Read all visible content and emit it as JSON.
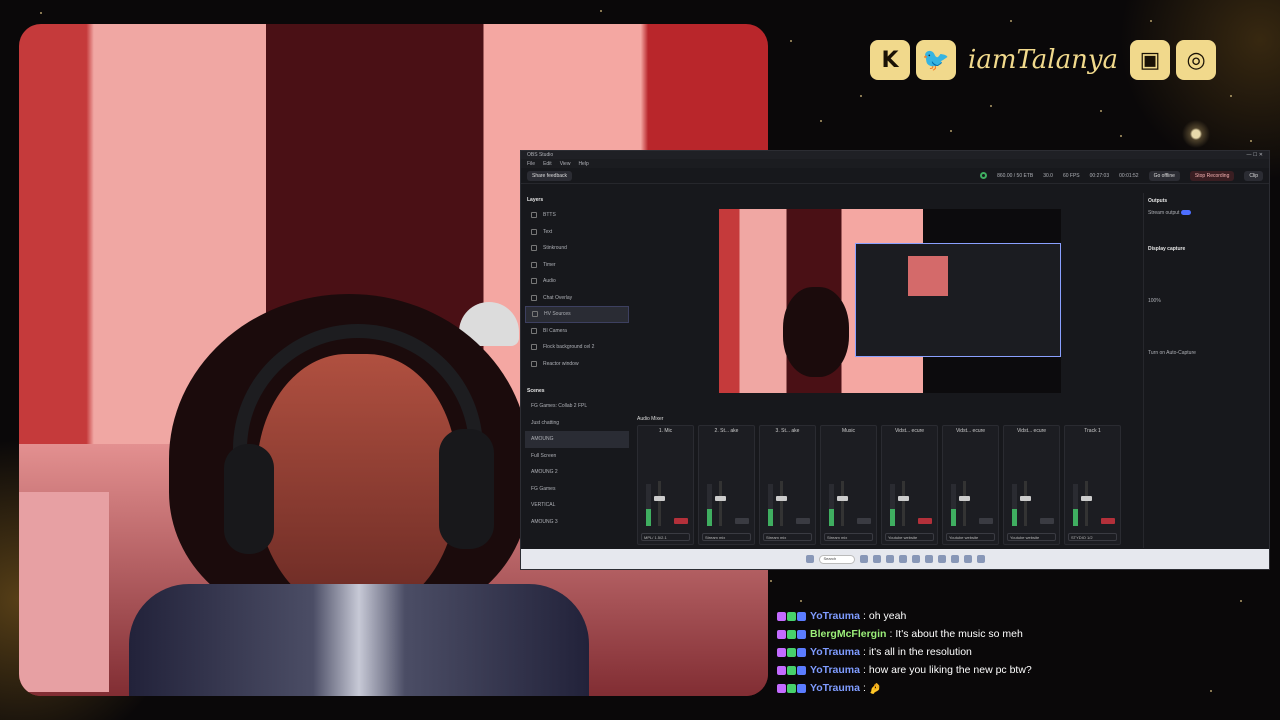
{
  "overlay": {
    "social_handle": "iamTalanya",
    "social_icons": [
      "kick-icon",
      "twitter-icon",
      "twitch-icon",
      "instagram-icon"
    ],
    "accent_color": "#f1d98c"
  },
  "obs": {
    "window_title": "OBS Studio",
    "menu": [
      "File",
      "Edit",
      "View",
      "Help"
    ],
    "share_feedback": "Share feedback",
    "stats": {
      "bitrate": "860.00 / 50 ETB",
      "cpu": "30.0",
      "fps": "60 FPS",
      "stream_time": "00:27:03",
      "rec_time": "00:01:52"
    },
    "go_offline": "Go offline",
    "stop_recording": "Stop Recording",
    "clip": "Clip",
    "layers_title": "Layers",
    "layers": [
      "BTTS",
      "Text",
      "Stinkround",
      "Timer",
      "Audio",
      "Chat Overlay",
      "HV Sources",
      "BI Camera",
      "Flock background cel 2",
      "Reactor window"
    ],
    "scenes_title": "Scenes",
    "scenes": [
      "FG Games: Collab 2 FPL",
      "Just chatting",
      "AMOUNG",
      "Full Screen",
      "AMOUNG 2",
      "FG Games",
      "VERTICAL",
      "AMOUNG 3"
    ],
    "audio_mixer_title": "Audio Mixer",
    "channels": [
      {
        "name": "1. Mic",
        "out": "MPL/ 1.5/2.1"
      },
      {
        "name": "2. St... ake",
        "out": "Stream mix"
      },
      {
        "name": "3. St... ake",
        "out": "Stream mix"
      },
      {
        "name": "Music",
        "out": "Stream mix"
      },
      {
        "name": "Vidst... ecure",
        "out": "Youtube website"
      },
      {
        "name": "Vidst... ecure",
        "out": "Youtube website"
      },
      {
        "name": "Vidst... ecure",
        "out": "Youtube website"
      },
      {
        "name": "Track 1",
        "out": "STYDIO 1/2"
      }
    ],
    "outputs_title": "Outputs",
    "stream_output": "Stream output",
    "display_capture": "Display capture",
    "opacity": "100%",
    "auto_capture": "Turn on Auto-Capture",
    "taskbar_search": "Search"
  },
  "chat": [
    {
      "user": "YoTrauma",
      "color": "#7f9cff",
      "text": "oh yeah"
    },
    {
      "user": "BlergMcFlergin",
      "color": "#9cf07a",
      "text": "It's about the music so meh"
    },
    {
      "user": "YoTrauma",
      "color": "#7f9cff",
      "text": "it's all in the resolution"
    },
    {
      "user": "YoTrauma",
      "color": "#7f9cff",
      "text": "how are you liking the new pc btw?"
    },
    {
      "user": "YoTrauma",
      "color": "#7f9cff",
      "text": "🤌"
    }
  ]
}
